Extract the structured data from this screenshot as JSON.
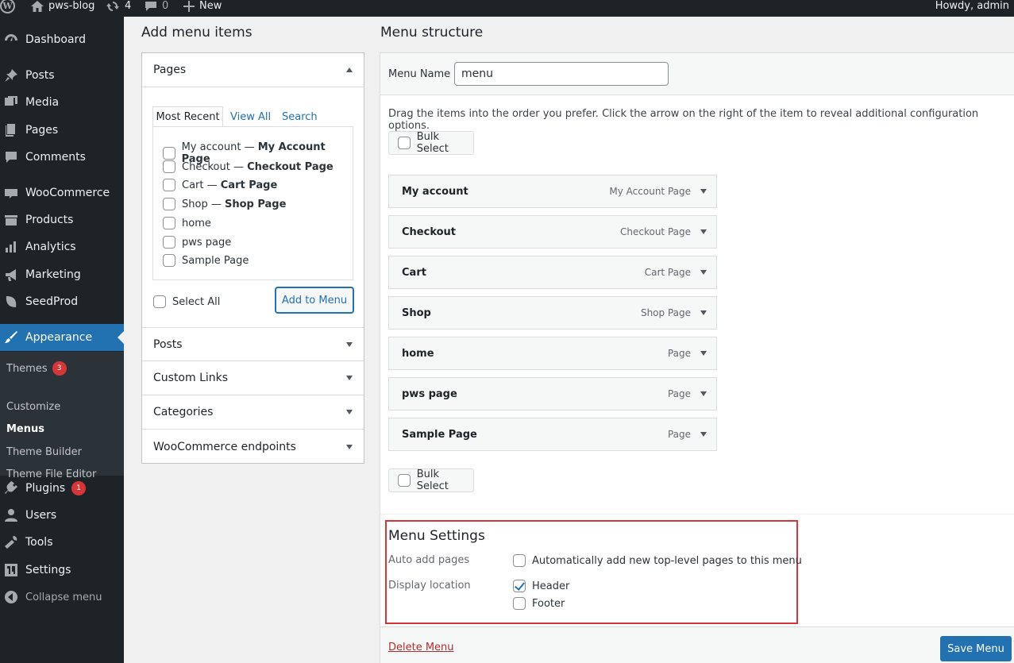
{
  "adminbar": {
    "site_name": "pws-blog",
    "updates_count": "4",
    "comments_count": "0",
    "new_label": "New",
    "howdy": "Howdy, admin"
  },
  "sidebar": {
    "items": [
      {
        "label": "Dashboard",
        "icon": "dashboard-icon"
      },
      {
        "label": "Posts",
        "icon": "pin-icon"
      },
      {
        "label": "Media",
        "icon": "media-icon"
      },
      {
        "label": "Pages",
        "icon": "pages-icon"
      },
      {
        "label": "Comments",
        "icon": "comments-icon"
      },
      {
        "label": "WooCommerce",
        "icon": "woocommerce-icon"
      },
      {
        "label": "Products",
        "icon": "products-icon"
      },
      {
        "label": "Analytics",
        "icon": "analytics-icon"
      },
      {
        "label": "Marketing",
        "icon": "megaphone-icon"
      },
      {
        "label": "SeedProd",
        "icon": "seedprod-icon"
      },
      {
        "label": "Appearance",
        "icon": "paintbrush-icon"
      },
      {
        "label": "Plugins",
        "icon": "plugin-icon",
        "badge": "1"
      },
      {
        "label": "Users",
        "icon": "users-icon"
      },
      {
        "label": "Tools",
        "icon": "wrench-icon"
      },
      {
        "label": "Settings",
        "icon": "settings-icon"
      }
    ],
    "submenu": [
      {
        "label": "Themes",
        "badge": "3"
      },
      {
        "label": "Customize"
      },
      {
        "label": "Menus"
      },
      {
        "label": "Theme Builder"
      },
      {
        "label": "Theme File Editor"
      }
    ],
    "collapse_label": "Collapse menu"
  },
  "add_items": {
    "title": "Add menu items",
    "pages_section": "Pages",
    "tabs": [
      "Most Recent",
      "View All",
      "Search"
    ],
    "pages": [
      {
        "name": "My account",
        "title": "My Account Page"
      },
      {
        "name": "Checkout",
        "title": "Checkout Page"
      },
      {
        "name": "Cart",
        "title": "Cart Page"
      },
      {
        "name": "Shop",
        "title": "Shop Page"
      },
      {
        "name": "home",
        "title": ""
      },
      {
        "name": "pws page",
        "title": ""
      },
      {
        "name": "Sample Page",
        "title": ""
      }
    ],
    "separator": " — ",
    "select_all": "Select All",
    "add_button": "Add to Menu",
    "other_sections": [
      "Posts",
      "Custom Links",
      "Categories",
      "WooCommerce endpoints"
    ]
  },
  "structure": {
    "title": "Menu structure",
    "menu_name_label": "Menu Name",
    "menu_name_value": "menu",
    "instructions": "Drag the items into the order you prefer. Click the arrow on the right of the item to reveal additional configuration options.",
    "bulk_select": "Bulk Select",
    "items": [
      {
        "title": "My account",
        "type": "My Account Page"
      },
      {
        "title": "Checkout",
        "type": "Checkout Page"
      },
      {
        "title": "Cart",
        "type": "Cart Page"
      },
      {
        "title": "Shop",
        "type": "Shop Page"
      },
      {
        "title": "home",
        "type": "Page"
      },
      {
        "title": "pws page",
        "type": "Page"
      },
      {
        "title": "Sample Page",
        "type": "Page"
      }
    ],
    "settings": {
      "title": "Menu Settings",
      "auto_add_label": "Auto add pages",
      "auto_add_option": "Automatically add new top-level pages to this menu",
      "display_location_label": "Display location",
      "locations": [
        {
          "label": "Header",
          "checked": true
        },
        {
          "label": "Footer",
          "checked": false
        }
      ]
    },
    "delete_label": "Delete Menu",
    "save_label": "Save Menu"
  },
  "colors": {
    "admin_dark": "#1d2327",
    "accent_blue": "#2271b1",
    "badge_red": "#d63638",
    "highlight_box": "#d63638"
  }
}
